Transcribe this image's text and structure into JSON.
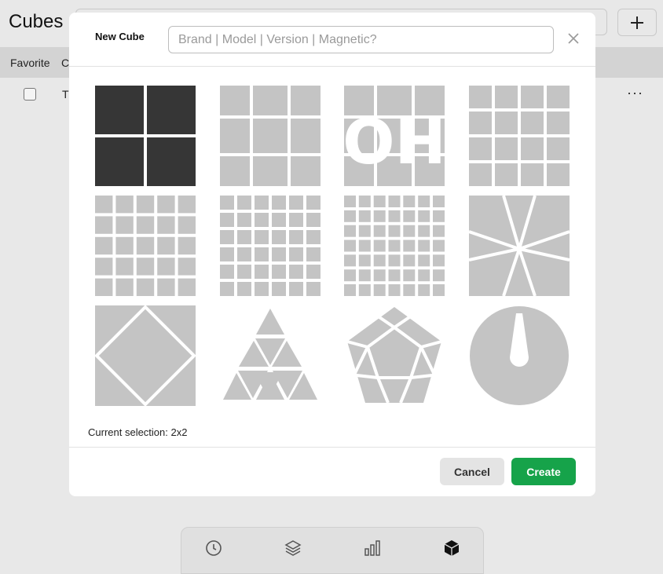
{
  "page": {
    "title": "Cubes",
    "columns": {
      "favorite": "Favorite",
      "second": "C"
    },
    "row": {
      "text": "T"
    },
    "row_menu": "···"
  },
  "nav": {
    "items": [
      {
        "icon": "clock-icon"
      },
      {
        "icon": "layers-icon"
      },
      {
        "icon": "bar-chart-icon"
      },
      {
        "icon": "cube-icon",
        "active": true
      }
    ]
  },
  "modal": {
    "title": "New Cube",
    "search_placeholder": "Brand | Model | Version | Magnetic?",
    "puzzles": [
      {
        "id": "2x2",
        "selected": true
      },
      {
        "id": "3x3"
      },
      {
        "id": "3x3-oh",
        "overlay_text": "OH"
      },
      {
        "id": "4x4"
      },
      {
        "id": "5x5"
      },
      {
        "id": "6x6"
      },
      {
        "id": "7x7"
      },
      {
        "id": "megaminx-square"
      },
      {
        "id": "skewb"
      },
      {
        "id": "pyraminx"
      },
      {
        "id": "megaminx"
      },
      {
        "id": "clock"
      }
    ],
    "selection_text": "Current selection: 2x2",
    "cancel_label": "Cancel",
    "create_label": "Create"
  },
  "colors": {
    "tile_gray": "#c4c4c4",
    "tile_selected": "#363636",
    "create_green": "#16a34a"
  }
}
